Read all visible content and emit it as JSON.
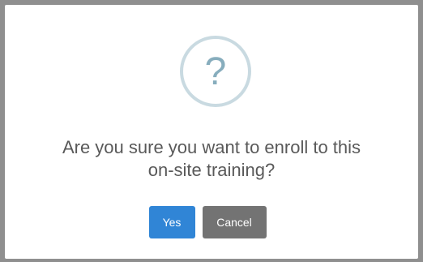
{
  "dialog": {
    "icon": {
      "name": "question-icon",
      "glyph": "?",
      "ring_color": "#c9dae1",
      "glyph_color": "#87adbd"
    },
    "message_line1": "Are you sure you want to enroll to this",
    "message_line2": "on-site training?",
    "confirm_label": "Yes",
    "cancel_label": "Cancel",
    "confirm_color": "#3085d6",
    "cancel_color": "#737373"
  }
}
